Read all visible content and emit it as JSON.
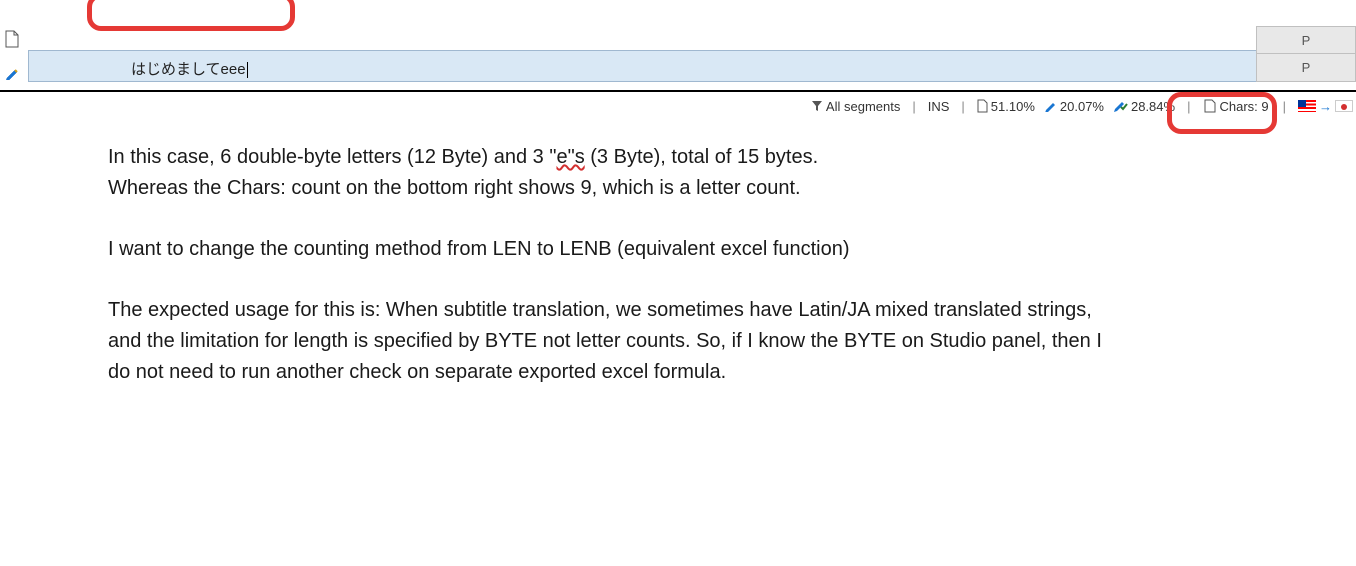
{
  "editor": {
    "translation_text": "はじめましてeee",
    "status_col": [
      "P",
      "P"
    ]
  },
  "status_bar": {
    "filter_label": "All segments",
    "ins_mode": "INS",
    "stat1": "51.10%",
    "stat2": "20.07%",
    "stat3": "28.84%",
    "chars_label": "Chars: 9"
  },
  "body": {
    "p1_a": "In this case, 6 double-byte letters (12 Byte) and 3 \"",
    "p1_squiggle": "e\"s",
    "p1_b": " (3 Byte), total of 15 bytes.",
    "p2": "Whereas the Chars: count on the bottom right shows 9, which is a letter count.",
    "p3": "I want to change the counting method from LEN to LENB (equivalent excel function)",
    "p4": "The expected usage for this is: When subtitle translation, we sometimes have Latin/JA mixed translated strings, and the limitation for length is specified by BYTE not letter counts. So, if I know the BYTE on Studio panel, then I do not need to run another check on separate exported excel formula."
  }
}
